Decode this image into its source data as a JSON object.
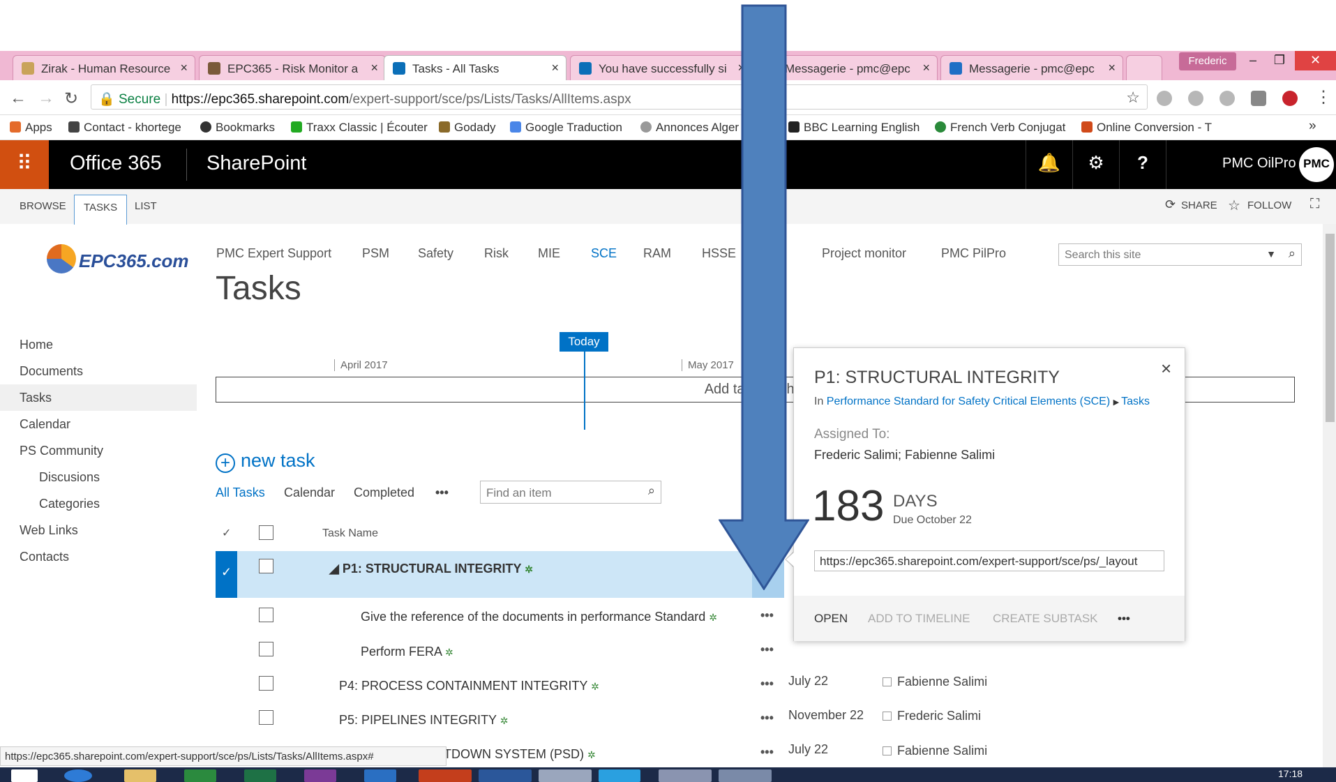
{
  "browser": {
    "tabs": [
      {
        "title": "Zirak - Human Resource",
        "active": false
      },
      {
        "title": "EPC365 - Risk Monitor a",
        "active": false
      },
      {
        "title": "Tasks - All Tasks",
        "active": true
      },
      {
        "title": "You have successfully si",
        "active": false
      },
      {
        "title": "Messagerie - pmc@epc",
        "active": false
      },
      {
        "title": "Messagerie - pmc@epc",
        "active": false
      }
    ],
    "profile": "Frederic",
    "url": {
      "secure": "Secure",
      "host": "https://epc365.sharepoint.com",
      "path": "/expert-support/sce/ps/Lists/Tasks/AllItems.aspx"
    },
    "bookmarks": [
      "Apps",
      "Contact - khortege",
      "Bookmarks",
      "Traxx Classic | Écouter",
      "Godady",
      "Google Traduction",
      "Annonces Alger",
      "BBC Learning English",
      "French Verb Conjugat",
      "Online Conversion - T"
    ],
    "more_bookmarks": "»",
    "status_url": "https://epc365.sharepoint.com/expert-support/sce/ps/Lists/Tasks/AllItems.aspx#"
  },
  "suite": {
    "app": "Office 365",
    "product": "SharePoint",
    "user": "PMC OilPro",
    "avatar": "PMC"
  },
  "ribbon": {
    "tabs": [
      "BROWSE",
      "TASKS",
      "LIST"
    ],
    "share": "SHARE",
    "follow": "FOLLOW"
  },
  "site": {
    "logo": "EPC365.com",
    "topnav": [
      "PMC Expert Support",
      "PSM",
      "Safety",
      "Risk",
      "MIE",
      "SCE",
      "RAM",
      "HSSE",
      "Project monitor",
      "PMC PilPro"
    ],
    "search_placeholder": "Search this site",
    "title": "Tasks",
    "quicklaunch": [
      "Home",
      "Documents",
      "Tasks",
      "Calendar",
      "PS Community",
      "Discusions",
      "Categories",
      "Web Links",
      "Contacts"
    ]
  },
  "timeline": {
    "today": "Today",
    "april": "April 2017",
    "may": "May 2017",
    "placeholder": "Add tasks with d"
  },
  "list": {
    "new_task": "new task",
    "views": [
      "All Tasks",
      "Calendar",
      "Completed"
    ],
    "more_views": "•••",
    "find_placeholder": "Find an item",
    "col_task": "Task Name",
    "rows": [
      {
        "name": "P1: STRUCTURAL INTEGRITY",
        "due": "",
        "assigned": ""
      },
      {
        "name": "Give the reference of the documents in performance Standard",
        "due": "",
        "assigned": ""
      },
      {
        "name": "Perform FERA",
        "due": "",
        "assigned": ""
      },
      {
        "name": "P4: PROCESS CONTAINMENT INTEGRITY",
        "due": "July 22",
        "assigned": "Fabienne Salimi"
      },
      {
        "name": "P5: PIPELINES INTEGRITY",
        "due": "November 22",
        "assigned": "Frederic Salimi"
      },
      {
        "name": "TDOWN SYSTEM (PSD)",
        "due": "July 22",
        "assigned": "Fabienne Salimi"
      }
    ]
  },
  "callout": {
    "title": "P1: STRUCTURAL INTEGRITY",
    "crumb_prefix": "In",
    "crumb_site": "Performance Standard for Safety Critical Elements (SCE)",
    "crumb_list": "Tasks",
    "assigned_label": "Assigned To:",
    "assigned": "Frederic Salimi; Fabienne Salimi",
    "days_num": "183",
    "days_label": "DAYS",
    "due": "Due October 22",
    "url": "https://epc365.sharepoint.com/expert-support/sce/ps/_layout",
    "actions": [
      "OPEN",
      "ADD TO TIMELINE",
      "CREATE SUBTASK"
    ],
    "more": "•••"
  },
  "os": {
    "clock": "17:18"
  },
  "colors": {
    "accent": "#0072c6",
    "suite_bar": "#000000",
    "waffle": "#d14f10",
    "arrow": "#4f81bd",
    "selected_row": "#cde6f7"
  }
}
